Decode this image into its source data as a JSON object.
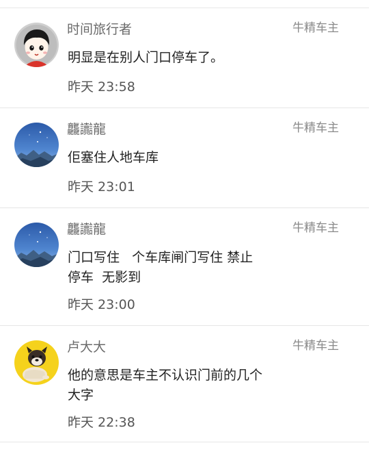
{
  "comments": [
    {
      "username": "时间旅行者",
      "badge": "牛精车主",
      "content": "明显是在别人门口停车了。",
      "time": "昨天 23:58",
      "avatar_icon": "cartoon-boy-avatar-icon"
    },
    {
      "username": "龘讟龍",
      "badge": "牛精车主",
      "content": "佢塞住人地车库",
      "time": "昨天 23:01",
      "avatar_icon": "night-sky-mountain-avatar-icon"
    },
    {
      "username": "龘讟龍",
      "badge": "牛精车主",
      "content": "门口写住   个车库闸门写住 禁止停车  无影到",
      "time": "昨天 23:00",
      "avatar_icon": "night-sky-mountain-avatar-icon"
    },
    {
      "username": "卢大大",
      "badge": "牛精车主",
      "content": "他的意思是车主不认识门前的几个大字",
      "time": "昨天 22:38",
      "avatar_icon": "bulldog-avatar-icon"
    }
  ],
  "colors": {
    "username": "#6b6b6b",
    "badge": "#8a8a8a",
    "content": "#222222",
    "time": "#555555",
    "divider": "#e6e6e6",
    "avatar_yellow": "#f5d21c"
  }
}
